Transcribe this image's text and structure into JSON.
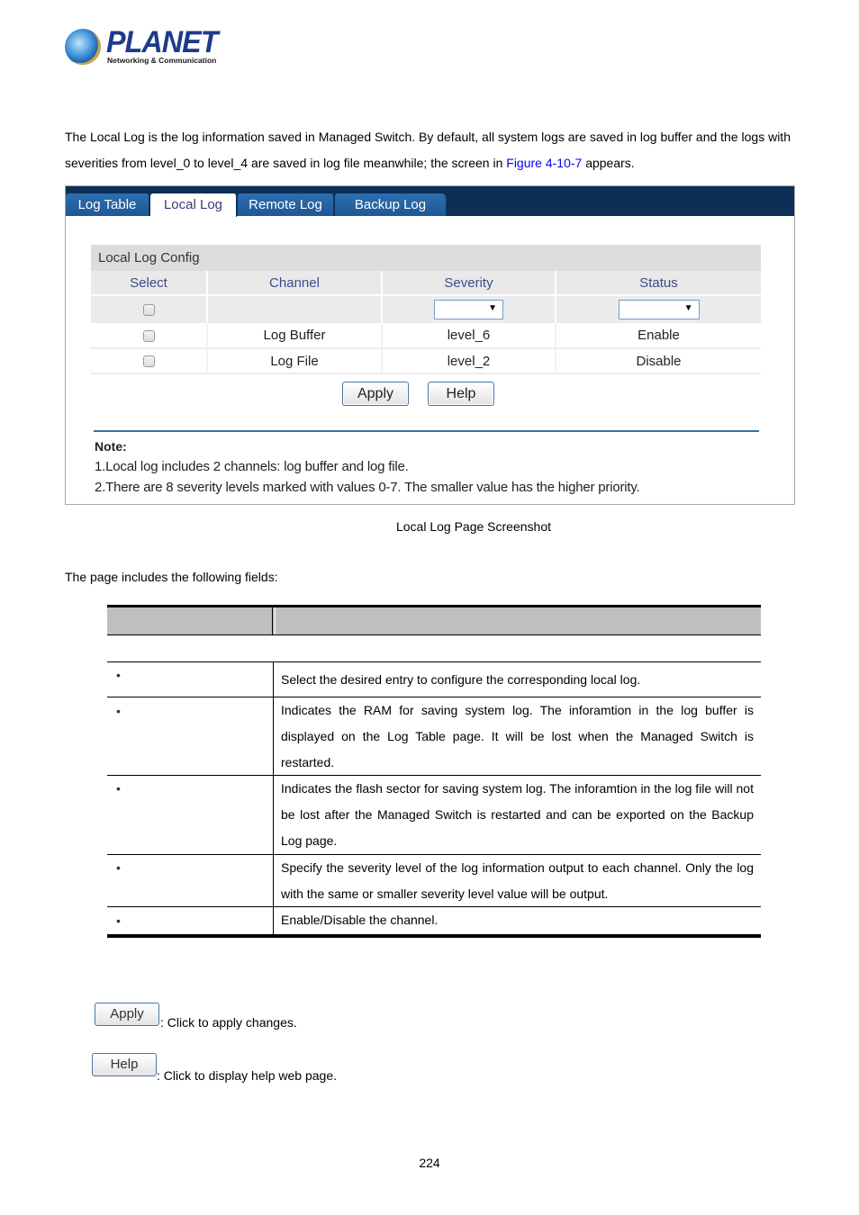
{
  "logo": {
    "brand": "PLANET",
    "tagline": "Networking & Communication"
  },
  "intro": {
    "text_before_link": "The Local Log is the log information saved in Managed Switch. By default, all system logs are saved in log buffer and the logs with severities from level_0 to level_4 are saved in log file meanwhile; the screen in ",
    "link_text": "Figure 4-10-7",
    "text_after_link": " appears."
  },
  "screenshot": {
    "tabs": [
      {
        "label": "Log Table",
        "active": false
      },
      {
        "label": "Local Log",
        "active": true
      },
      {
        "label": "Remote Log",
        "active": false
      },
      {
        "label": "Backup Log",
        "active": false
      }
    ],
    "config": {
      "title": "Local Log Config",
      "columns": [
        "Select",
        "Channel",
        "Severity",
        "Status"
      ],
      "edit_row": {
        "severity_value": "",
        "status_value": "",
        "dropdown_arrow": "▼"
      },
      "rows": [
        {
          "selected": false,
          "channel": "Log Buffer",
          "severity": "level_6",
          "status": "Enable"
        },
        {
          "selected": false,
          "channel": "Log File",
          "severity": "level_2",
          "status": "Disable"
        }
      ]
    },
    "buttons": {
      "apply": "Apply",
      "help": "Help"
    },
    "note": {
      "label": "Note:",
      "lines": [
        "1.Local log includes 2 channels: log buffer and log file.",
        "2.There are 8 severity levels marked with values 0-7. The smaller value has the higher priority."
      ]
    }
  },
  "caption": "Local Log Page Screenshot",
  "fields_intro": "The page includes the following fields:",
  "fields_table": {
    "header": [
      "",
      ""
    ],
    "bullet": "•",
    "rows": [
      {
        "object": "",
        "description": "Select the desired entry to configure the corresponding local log."
      },
      {
        "object": "",
        "description": "Indicates the RAM for saving system log. The inforamtion in the log buffer is displayed on the Log Table page. It will be lost when the Managed Switch is restarted."
      },
      {
        "object": "",
        "description": "Indicates the flash sector for saving system log. The inforamtion in the log file will not be lost after the Managed Switch is restarted and can be exported on the Backup Log page."
      },
      {
        "object": "",
        "description": "Specify the severity level of the log information output to each channel. Only the log with the same or smaller severity level value will be output."
      },
      {
        "object": "",
        "description": "Enable/Disable the channel."
      }
    ]
  },
  "button_legend": [
    {
      "label": "Apply",
      "text": ": Click to apply changes."
    },
    {
      "label": "Help",
      "text": ": Click to display help web page."
    }
  ],
  "page_number": "224"
}
